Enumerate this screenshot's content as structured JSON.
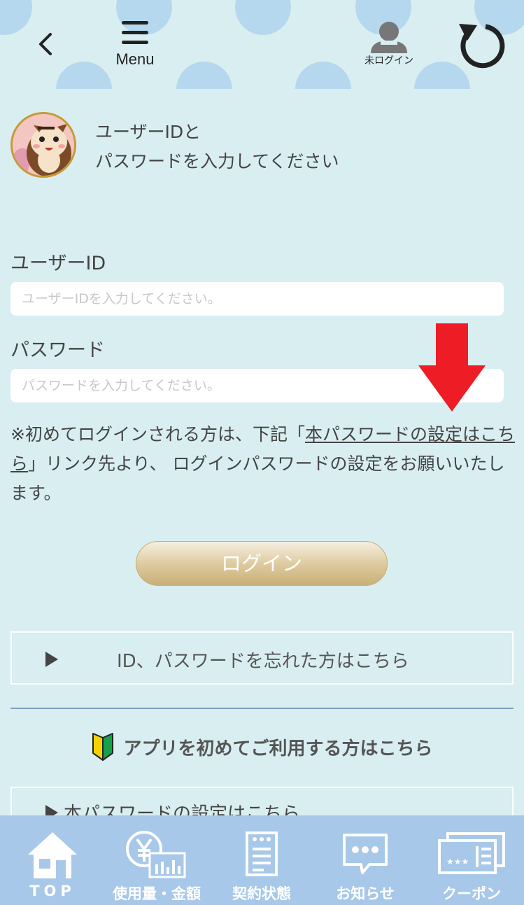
{
  "header": {
    "menu_label": "Menu",
    "login_status": "未ログイン"
  },
  "intro": {
    "line1": "ユーザーIDと",
    "line2": "パスワードを入力してください"
  },
  "form": {
    "user_id_label": "ユーザーID",
    "user_id_placeholder": "ユーザーIDを入力してください。",
    "password_label": "パスワード",
    "password_placeholder": "パスワードを入力してください。"
  },
  "notice": {
    "part1": "※初めてログインされる方は、下記「",
    "link": "本パスワードの設定はこちら",
    "part2": "」リンク先より、 ログインパスワードの設定をお願いいたします。"
  },
  "login_button": "ログイン",
  "forgot_link": "ID、パスワードを忘れた方はこちら",
  "first_time_heading": "アプリを初めてご利用する方はこちら",
  "set_password_link": "本パスワードの設定はこちら",
  "tabs": [
    {
      "label": "TOP",
      "icon": "house-icon"
    },
    {
      "label": "使用量・金額",
      "icon": "yen-chart-icon"
    },
    {
      "label": "契約状態",
      "icon": "document-icon"
    },
    {
      "label": "お知らせ",
      "icon": "speech-bubble-icon"
    },
    {
      "label": "クーポン",
      "icon": "ticket-icon"
    }
  ],
  "colors": {
    "background": "#d9eef0",
    "header_dots": "#b5d8ee",
    "tabbar": "#a7c8e8",
    "login_button_gold": "#dcc89c",
    "arrow_red": "#ee1c25"
  }
}
